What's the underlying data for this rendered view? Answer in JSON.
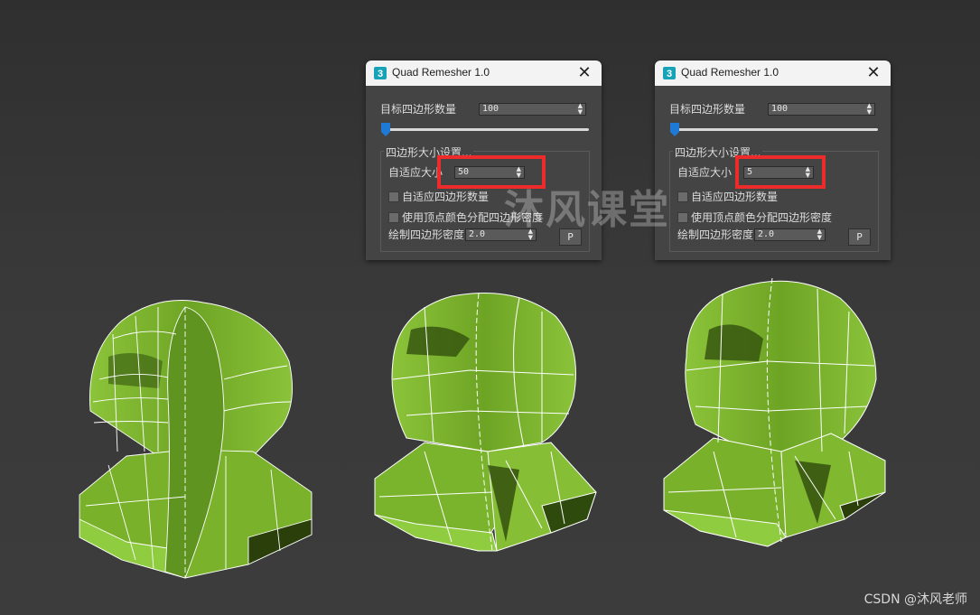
{
  "dialogs": [
    {
      "title": "Quad Remesher 1.0",
      "target_quad_count_label": "目标四边形数量",
      "target_quad_count_value": "100",
      "quad_size_group_label": "四边形大小设置...",
      "adaptive_size_label": "自适应大小",
      "adaptive_size_value": "50",
      "adaptive_quad_count_label": "自适应四边形数量",
      "use_vertex_color_label": "使用顶点颜色分配四边形密度",
      "paint_density_label": "绘制四边形密度",
      "paint_density_value": "2.0",
      "p_button_label": "P"
    },
    {
      "title": "Quad Remesher 1.0",
      "target_quad_count_label": "目标四边形数量",
      "target_quad_count_value": "100",
      "quad_size_group_label": "四边形大小设置...",
      "adaptive_size_label": "自适应大小",
      "adaptive_size_value": "5",
      "adaptive_quad_count_label": "自适应四边形数量",
      "use_vertex_color_label": "使用顶点颜色分配四边形密度",
      "paint_density_label": "绘制四边形密度",
      "paint_density_value": "2.0",
      "p_button_label": "P"
    }
  ],
  "watermark": "沐风课堂",
  "credit": "CSDN @沐风老师",
  "colors": {
    "mesh_green": "#7db82e",
    "mesh_dark": "#3f6312",
    "highlight": "#ee2b2b",
    "slider_thumb": "#1f7ad6",
    "dialog_bg": "#444444",
    "titlebar_bg": "#f3f3f3"
  },
  "icons": {
    "app": "3ds-max-app-icon",
    "close": "close-icon"
  }
}
